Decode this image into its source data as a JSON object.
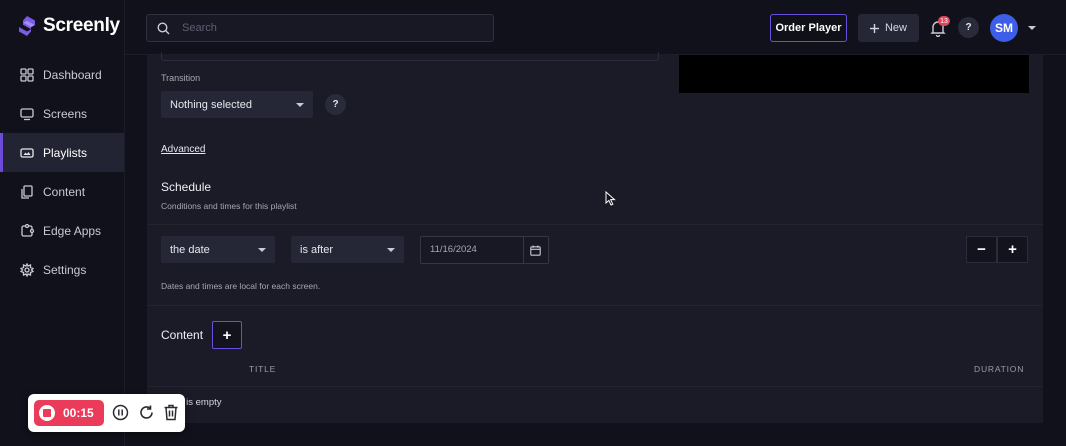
{
  "app": {
    "name": "Screenly"
  },
  "sidebar": {
    "items": [
      {
        "label": "Dashboard",
        "icon": "dashboard-icon"
      },
      {
        "label": "Screens",
        "icon": "monitor-icon"
      },
      {
        "label": "Playlists",
        "icon": "playlist-icon"
      },
      {
        "label": "Content",
        "icon": "file-icon"
      },
      {
        "label": "Edge Apps",
        "icon": "puzzle-icon"
      },
      {
        "label": "Settings",
        "icon": "gear-icon"
      }
    ],
    "active": "Playlists"
  },
  "header": {
    "search_placeholder": "Search",
    "order_player_label": "Order Player",
    "new_label": "New",
    "notification_count": "13",
    "help_label": "?",
    "avatar_initials": "SM"
  },
  "form": {
    "transition": {
      "label": "Transition",
      "value": "Nothing selected",
      "help_label": "?"
    },
    "advanced_link": "Advanced",
    "schedule": {
      "title": "Schedule",
      "subtitle": "Conditions and times for this playlist",
      "field_select": "the date",
      "operator_select": "is after",
      "date_value": "11/16/2024",
      "minus_label": "−",
      "plus_label": "+",
      "note": "Dates and times are local for each screen."
    },
    "content": {
      "title": "Content",
      "add_label": "+",
      "columns": [
        "TITLE",
        "DURATION"
      ],
      "empty_message": "ist is empty"
    }
  },
  "recorder": {
    "time": "00:15"
  },
  "colors": {
    "accent": "#6a4ee0",
    "record": "#ea3b5b",
    "avatar": "#3d5ee6",
    "background": "#10111a",
    "panel": "#1a1b26"
  }
}
